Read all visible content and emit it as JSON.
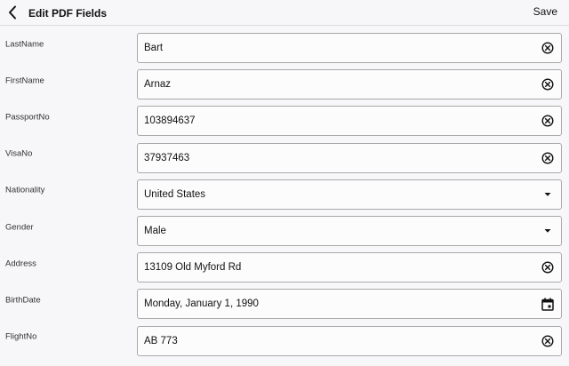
{
  "header": {
    "title": "Edit PDF Fields",
    "save_label": "Save"
  },
  "fields": [
    {
      "label": "LastName",
      "value": "Bart",
      "kind": "text",
      "icon": "clear-icon"
    },
    {
      "label": "FirstName",
      "value": "Arnaz",
      "kind": "text",
      "icon": "clear-icon"
    },
    {
      "label": "PassportNo",
      "value": "103894637",
      "kind": "text",
      "icon": "clear-icon"
    },
    {
      "label": "VisaNo",
      "value": "37937463",
      "kind": "text",
      "icon": "clear-icon"
    },
    {
      "label": "Nationality",
      "value": "United States",
      "kind": "dropdown",
      "icon": "dropdown-arrow-icon"
    },
    {
      "label": "Gender",
      "value": "Male",
      "kind": "dropdown",
      "icon": "dropdown-arrow-icon"
    },
    {
      "label": "Address",
      "value": "13109 Old Myford Rd",
      "kind": "text",
      "icon": "clear-icon"
    },
    {
      "label": "BirthDate",
      "value": "Monday, January 1, 1990",
      "kind": "date",
      "icon": "calendar-icon"
    },
    {
      "label": "FlightNo",
      "value": "AB 773",
      "kind": "text",
      "icon": "clear-icon"
    }
  ]
}
